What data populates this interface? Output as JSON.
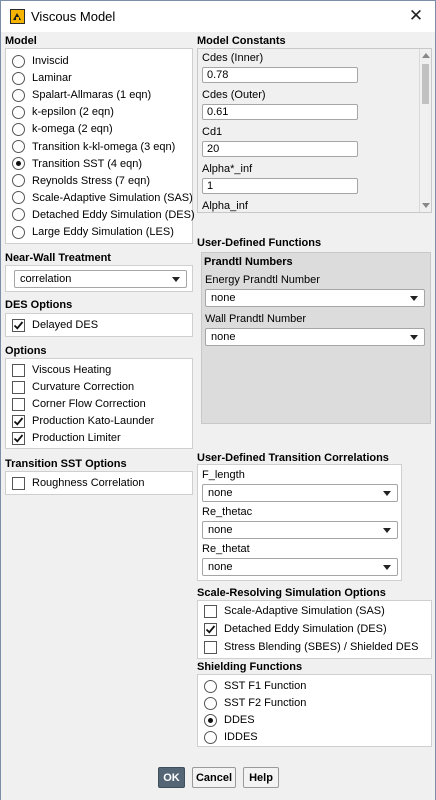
{
  "window": {
    "title": "Viscous Model",
    "icon": "fluent-app-icon",
    "close_icon": "close-icon"
  },
  "model": {
    "label": "Model",
    "options": [
      {
        "label": "Inviscid",
        "selected": false
      },
      {
        "label": "Laminar",
        "selected": false
      },
      {
        "label": "Spalart-Allmaras (1 eqn)",
        "selected": false
      },
      {
        "label": "k-epsilon (2 eqn)",
        "selected": false
      },
      {
        "label": "k-omega (2 eqn)",
        "selected": false
      },
      {
        "label": "Transition k-kl-omega (3 eqn)",
        "selected": false
      },
      {
        "label": "Transition SST (4 eqn)",
        "selected": true
      },
      {
        "label": "Reynolds Stress (7 eqn)",
        "selected": false
      },
      {
        "label": "Scale-Adaptive Simulation (SAS)",
        "selected": false
      },
      {
        "label": "Detached Eddy Simulation (DES)",
        "selected": false
      },
      {
        "label": "Large Eddy Simulation (LES)",
        "selected": false
      }
    ]
  },
  "near_wall": {
    "label": "Near-Wall Treatment",
    "value": "correlation"
  },
  "des_options": {
    "label": "DES Options",
    "items": [
      {
        "label": "Delayed DES",
        "checked": true
      }
    ]
  },
  "options": {
    "label": "Options",
    "items": [
      {
        "label": "Viscous Heating",
        "checked": false
      },
      {
        "label": "Curvature Correction",
        "checked": false
      },
      {
        "label": "Corner Flow Correction",
        "checked": false
      },
      {
        "label": "Production Kato-Launder",
        "checked": true
      },
      {
        "label": "Production Limiter",
        "checked": true
      }
    ]
  },
  "transition_sst": {
    "label": "Transition SST Options",
    "items": [
      {
        "label": "Roughness Correlation",
        "checked": false
      }
    ]
  },
  "model_constants": {
    "label": "Model Constants",
    "items": [
      {
        "label": "Cdes (Inner)",
        "value": "0.78"
      },
      {
        "label": "Cdes (Outer)",
        "value": "0.61"
      },
      {
        "label": "Cd1",
        "value": "20"
      },
      {
        "label": "Alpha*_inf",
        "value": "1"
      },
      {
        "label": "Alpha_inf",
        "value": ""
      }
    ]
  },
  "udf": {
    "label": "User-Defined Functions",
    "prandtl_label": "Prandtl Numbers",
    "energy_label": "Energy Prandtl Number",
    "energy_value": "none",
    "wall_label": "Wall Prandtl Number",
    "wall_value": "none"
  },
  "udtc": {
    "label": "User-Defined Transition Correlations",
    "items": [
      {
        "label": "F_length",
        "value": "none"
      },
      {
        "label": "Re_thetac",
        "value": "none"
      },
      {
        "label": "Re_thetat",
        "value": "none"
      }
    ]
  },
  "scale_resolving": {
    "label": "Scale-Resolving Simulation Options",
    "items": [
      {
        "label": "Scale-Adaptive Simulation (SAS)",
        "checked": false
      },
      {
        "label": "Detached Eddy Simulation (DES)",
        "checked": true
      },
      {
        "label": "Stress Blending (SBES) / Shielded DES",
        "checked": false
      }
    ]
  },
  "shielding": {
    "label": "Shielding Functions",
    "options": [
      {
        "label": "SST F1 Function",
        "selected": false
      },
      {
        "label": "SST F2 Function",
        "selected": false
      },
      {
        "label": "DDES",
        "selected": true
      },
      {
        "label": "IDDES",
        "selected": false
      }
    ]
  },
  "buttons": {
    "ok": "OK",
    "cancel": "Cancel",
    "help": "Help"
  }
}
